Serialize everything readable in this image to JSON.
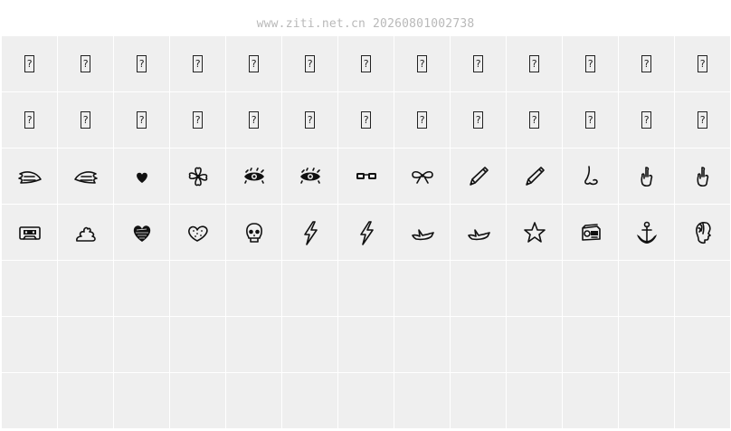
{
  "header": {
    "watermark": "www.ziti.net.cn 20260801002738"
  },
  "glyph_rows": [
    {
      "kind": "missing",
      "cells": [
        "?",
        "?",
        "?",
        "?",
        "?",
        "?",
        "?",
        "?",
        "?",
        "?",
        "?",
        "?",
        "?"
      ]
    },
    {
      "kind": "missing",
      "cells": [
        "?",
        "?",
        "?",
        "?",
        "?",
        "?",
        "?",
        "?",
        "?",
        "?",
        "?",
        "?",
        "?"
      ]
    },
    {
      "kind": "icons",
      "cells": [
        "wing-left-icon",
        "wing-right-icon",
        "small-heart-icon",
        "flower-icon",
        "eye-icon",
        "eye-icon",
        "glasses-icon",
        "bow-tie-icon",
        "pencil-icon",
        "pencil-icon",
        "nose-icon",
        "hand-gesture-icon",
        "hand-gesture-icon"
      ]
    },
    {
      "kind": "icons",
      "cells": [
        "cassette-icon",
        "swirl-icon",
        "scribble-heart-icon",
        "dotted-heart-icon",
        "skull-icon",
        "lightning-icon",
        "lightning-icon",
        "bird-icon",
        "bird-icon",
        "star-icon",
        "radio-icon",
        "anchor-icon",
        "face-profile-icon"
      ]
    },
    {
      "kind": "empty",
      "cells": [
        "",
        "",
        "",
        "",
        "",
        "",
        "",
        "",
        "",
        "",
        "",
        "",
        ""
      ]
    },
    {
      "kind": "empty",
      "cells": [
        "",
        "",
        "",
        "",
        "",
        "",
        "",
        "",
        "",
        "",
        "",
        "",
        ""
      ]
    },
    {
      "kind": "empty",
      "cells": [
        "",
        "",
        "",
        "",
        "",
        "",
        "",
        "",
        "",
        "",
        "",
        "",
        ""
      ]
    }
  ]
}
